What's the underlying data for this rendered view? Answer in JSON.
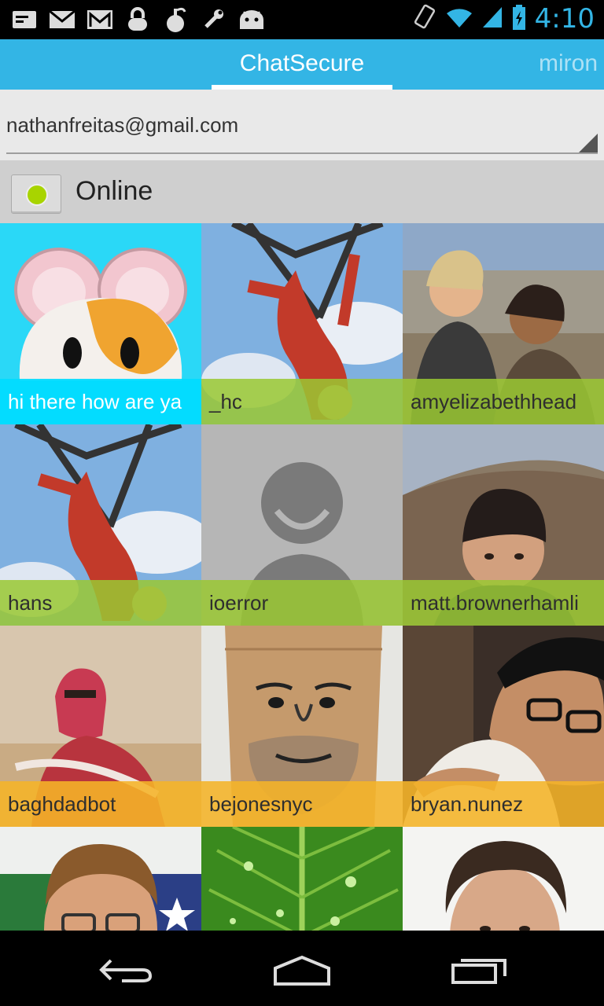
{
  "status_bar": {
    "time": "4:10",
    "icons": [
      "notification-icon",
      "mail-icon",
      "gmail-icon",
      "lock-icon",
      "gourd-icon",
      "tools-icon",
      "android-icon",
      "rotation-icon",
      "wifi-icon",
      "signal-icon",
      "battery-charging-icon"
    ]
  },
  "tabs": {
    "active_label": "ChatSecure",
    "next_label": "miron"
  },
  "account": {
    "selected": "nathanfreitas@gmail.com"
  },
  "presence": {
    "status": "Online",
    "status_color": "#a8d400"
  },
  "contacts": [
    {
      "name": "hi there how are ya",
      "label_style": "cyan",
      "avatar": "hamster-emoji"
    },
    {
      "name": "_hc",
      "label_style": "green",
      "avatar": "person-on-swing-photo"
    },
    {
      "name": "amyelizabethhead",
      "label_style": "green",
      "avatar": "two-women-photo"
    },
    {
      "name": "hans",
      "label_style": "green",
      "avatar": "person-on-swing-photo"
    },
    {
      "name": "ioerror",
      "label_style": "green",
      "avatar": "default-avatar-icon"
    },
    {
      "name": "matt.brownerhamli",
      "label_style": "green",
      "avatar": "man-beanie-photo"
    },
    {
      "name": "baghdadbot",
      "label_style": "orange",
      "avatar": "desert-scarf-photo"
    },
    {
      "name": "bejonesnyc",
      "label_style": "orange",
      "avatar": "paper-bag-face-photo"
    },
    {
      "name": "bryan.nunez",
      "label_style": "orange",
      "avatar": "man-glasses-photo"
    },
    {
      "name": "",
      "label_style": "none",
      "avatar": "man-flag-photo"
    },
    {
      "name": "",
      "label_style": "none",
      "avatar": "green-leaf-photo"
    },
    {
      "name": "",
      "label_style": "none",
      "avatar": "man-portrait-photo"
    }
  ],
  "nav": {
    "buttons": [
      "back-icon",
      "home-icon",
      "recents-icon"
    ]
  }
}
